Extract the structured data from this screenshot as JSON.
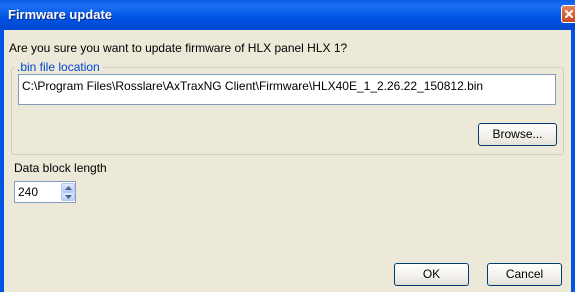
{
  "window": {
    "title": "Firmware update"
  },
  "dialog": {
    "question": "Are you sure you want to update firmware of HLX panel HLX 1?",
    "bin_group_label": ".bin  file location",
    "bin_path": "C:\\Program Files\\Rosslare\\AxTraxNG Client\\Firmware\\HLX40E_1_2.26.22_150812.bin",
    "browse_label": "Browse...",
    "data_block_label": "Data block length",
    "data_block_value": "240",
    "ok_label": "OK",
    "cancel_label": "Cancel"
  },
  "icons": {
    "close": "close-icon",
    "spin_up": "arrow-up-icon",
    "spin_down": "arrow-down-icon"
  },
  "colors": {
    "titlebar": "#0055e5",
    "client_bg": "#ece9d8",
    "group_label": "#0046d5",
    "close_button": "#c8441f"
  }
}
